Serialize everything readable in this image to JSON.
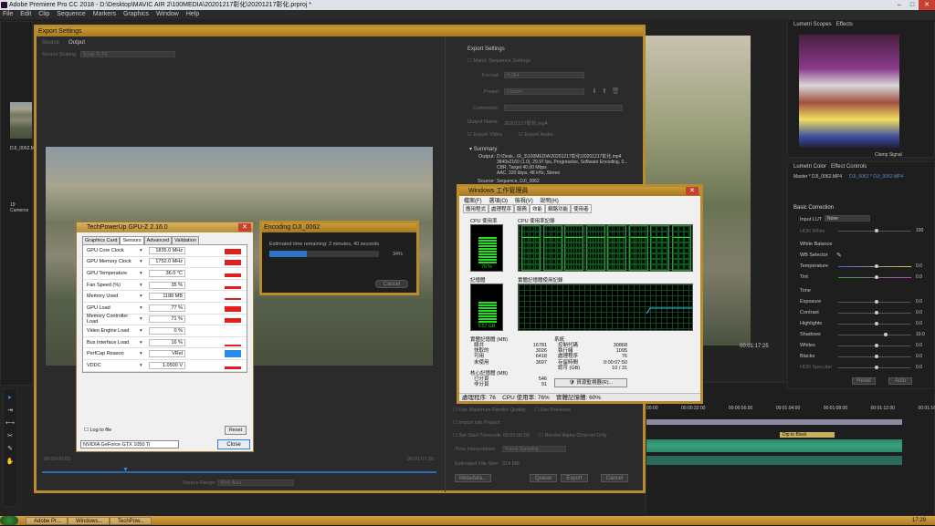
{
  "app": {
    "title": "Adobe Premiere Pro CC 2018 - D:\\Desktop\\MAVIC AIR 2\\100MEDIA\\20201217彰化\\20201217彰化.prproj *",
    "menu": [
      "File",
      "Edit",
      "Clip",
      "Sequence",
      "Markers",
      "Graphics",
      "Window",
      "Help"
    ]
  },
  "project": {
    "items": [
      "DJI_0062.MP4",
      "19 Cumerce"
    ]
  },
  "export_settings": {
    "title": "Export Settings",
    "tabs": [
      "Source",
      "Output"
    ],
    "source_scaling_label": "Source Scaling:",
    "source_scaling_value": "Scale To Fit",
    "section_title": "Export Settings",
    "match_sequence": "Match Sequence Settings",
    "format_label": "Format:",
    "format_value": "H.264",
    "preset_label": "Preset:",
    "preset_value": "Custom",
    "comments_label": "Comments:",
    "output_name_label": "Output Name:",
    "output_name_value": "20201217彰化.mp4",
    "export_video": "Export Video",
    "export_audio": "Export Audio",
    "summary_title": "Summary",
    "output_label": "Output:",
    "output_lines": [
      "D:\\Desk...\\R_3\\100MEDIA\\20201217彰化\\20201217彰化.mp4",
      "3840x2160 (1.0), 29.97 fps, Progressive, Software Encoding, 0...",
      "CBR, Target 40.00 Mbps",
      "AAC, 320 kbps, 48 kHz, Stereo"
    ],
    "source_label": "Source:",
    "source_lines": [
      "Sequence, DJI_0062"
    ],
    "use_max_render": "Use Maximum Render Quality",
    "use_previews": "Use Previews",
    "import_into_project": "Import into Project",
    "set_start_timecode": "Set Start Timecode",
    "start_timecode": "00:00:00:00",
    "render_alpha": "Render Alpha Channel Only",
    "time_interpolation_label": "Time Interpolation:",
    "time_interpolation_value": "Frame Sampling",
    "file_size_label": "Estimated File Size:",
    "file_size_value": "314 MB",
    "buttons": [
      "Metadata...",
      "Queue",
      "Export",
      "Cancel"
    ],
    "timecode_left": "00:00:00:03",
    "timecode_right": "00:01:07:20",
    "source_range_label": "Source Range:",
    "source_range_value": "Work Area"
  },
  "gpuz": {
    "title": "TechPowerUp GPU-Z 2.16.0",
    "tabs": [
      "Graphics Card",
      "Sensors",
      "Advanced",
      "Validation"
    ],
    "sensors": [
      {
        "name": "GPU Core Clock",
        "value": "1835.0 MHz",
        "level": 0.75
      },
      {
        "name": "GPU Memory Clock",
        "value": "1752.0 MHz",
        "level": 0.75
      },
      {
        "name": "GPU Temperature",
        "value": "36.0 °C",
        "level": 0.45
      },
      {
        "name": "Fan Speed (%)",
        "value": "35 %",
        "level": 0.35
      },
      {
        "name": "Memory Used",
        "value": "1188 MB",
        "level": 0.3
      },
      {
        "name": "GPU Load",
        "value": "77 %",
        "level": 0.77
      },
      {
        "name": "Memory Controller Load",
        "value": "71 %",
        "level": 0.65
      },
      {
        "name": "Video Engine Load",
        "value": "0 %",
        "level": 0
      },
      {
        "name": "Bus Interface Load",
        "value": "16 %",
        "level": 0.2
      },
      {
        "name": "PerfCap Reason",
        "value": "VRel",
        "level": 1
      },
      {
        "name": "VDDC",
        "value": "1.0500 V",
        "level": 0.4
      }
    ],
    "log_to_file": "Log to file",
    "reset": "Reset",
    "gpu_select": "NVIDIA GeForce GTX 1050 Ti",
    "close": "Close"
  },
  "encoding": {
    "title": "Encoding DJI_0062",
    "remaining": "Estimated time remaining: 2 minutes, 40 seconds",
    "percent_label": "34%",
    "progress": 0.34,
    "cancel": "Cancel"
  },
  "taskmgr": {
    "title": "Windows 工作管理員",
    "menu": [
      "檔案(F)",
      "選項(O)",
      "檢視(V)",
      "說明(H)"
    ],
    "tabs": [
      "應用程式",
      "處理程序",
      "服務",
      "效能",
      "網路功能",
      "使用者"
    ],
    "cpu_usage_label": "CPU 使用率",
    "cpu_history_label": "CPU 使用率記錄",
    "cpu_usage_value": "76 %",
    "cpu_usage": 0.76,
    "memory_label": "記憶體",
    "memory_history_label": "實體記憶體使用記錄",
    "memory_value": "9.57 GB",
    "memory_usage": 0.6,
    "physical_memory_title": "實體記憶體 (MB)",
    "physical_memory": [
      [
        "總共",
        "16781"
      ],
      [
        "快取的",
        "3026"
      ],
      [
        "可用",
        "6418"
      ],
      [
        "未使用",
        "3697"
      ]
    ],
    "system_title": "系統",
    "system": [
      [
        "控制代碼",
        "30868"
      ],
      [
        "執行緒",
        "1095"
      ],
      [
        "處理程序",
        "76"
      ],
      [
        "存留時間",
        "0:00:07:50"
      ],
      [
        "認可 (GB)",
        "10 / 31"
      ]
    ],
    "kernel_title": "核心記憶體 (MB)",
    "kernel": [
      [
        "已分頁",
        "546"
      ],
      [
        "非分頁",
        "91"
      ]
    ],
    "resource_monitor": "資源監視器(R)...",
    "status": [
      "處理程序: 76",
      "CPU 使用率: 76%",
      "實體記憶體: 60%"
    ]
  },
  "right_panel": {
    "scope_tab": "Lumetri Scopes",
    "effects_tab": "Effects",
    "lumetri_tab": "Lumetri Color",
    "effect_controls_tab": "Effect Controls",
    "clip_label": "Master * DJI_0062.MP4",
    "clip_label2": "DJI_0062 * DJI_0062.MP4",
    "clamp_signal": "Clamp Signal",
    "basic_correction": "Basic Correction",
    "input_lut": "Input LUT",
    "input_lut_value": "None",
    "hdr_white": "HDR White",
    "white_balance": "White Balance",
    "wb_selector": "WB Selector",
    "temperature": "Temperature",
    "tint": "Tint",
    "tone": "Tone",
    "exposure": "Exposure",
    "contrast": "Contrast",
    "highlights": "Highlights",
    "shadows": "Shadows",
    "whites": "Whites",
    "blacks": "Blacks",
    "hdr_specular": "HDR Specular",
    "values": [
      "100",
      "0.0",
      "0.0",
      "0.0",
      "0.0",
      "0.0",
      "0.0",
      "10.0",
      "0.0",
      "0.0",
      "0.0"
    ],
    "reset": "Reset",
    "auto": "Auto",
    "program_timecode": "00:01:17:25"
  },
  "timeline": {
    "ruler": [
      "00:00",
      "00:00:32:00",
      "00:00:56:00",
      "00:01:04:00",
      "00:01:08:00",
      "00:01:12:00",
      "00:01:16"
    ],
    "clip_label": "Dip to Black"
  },
  "taskbar": {
    "items": [
      "Adobe Pr...",
      "Windows...",
      "TechPow..."
    ],
    "clock": "17:29"
  }
}
